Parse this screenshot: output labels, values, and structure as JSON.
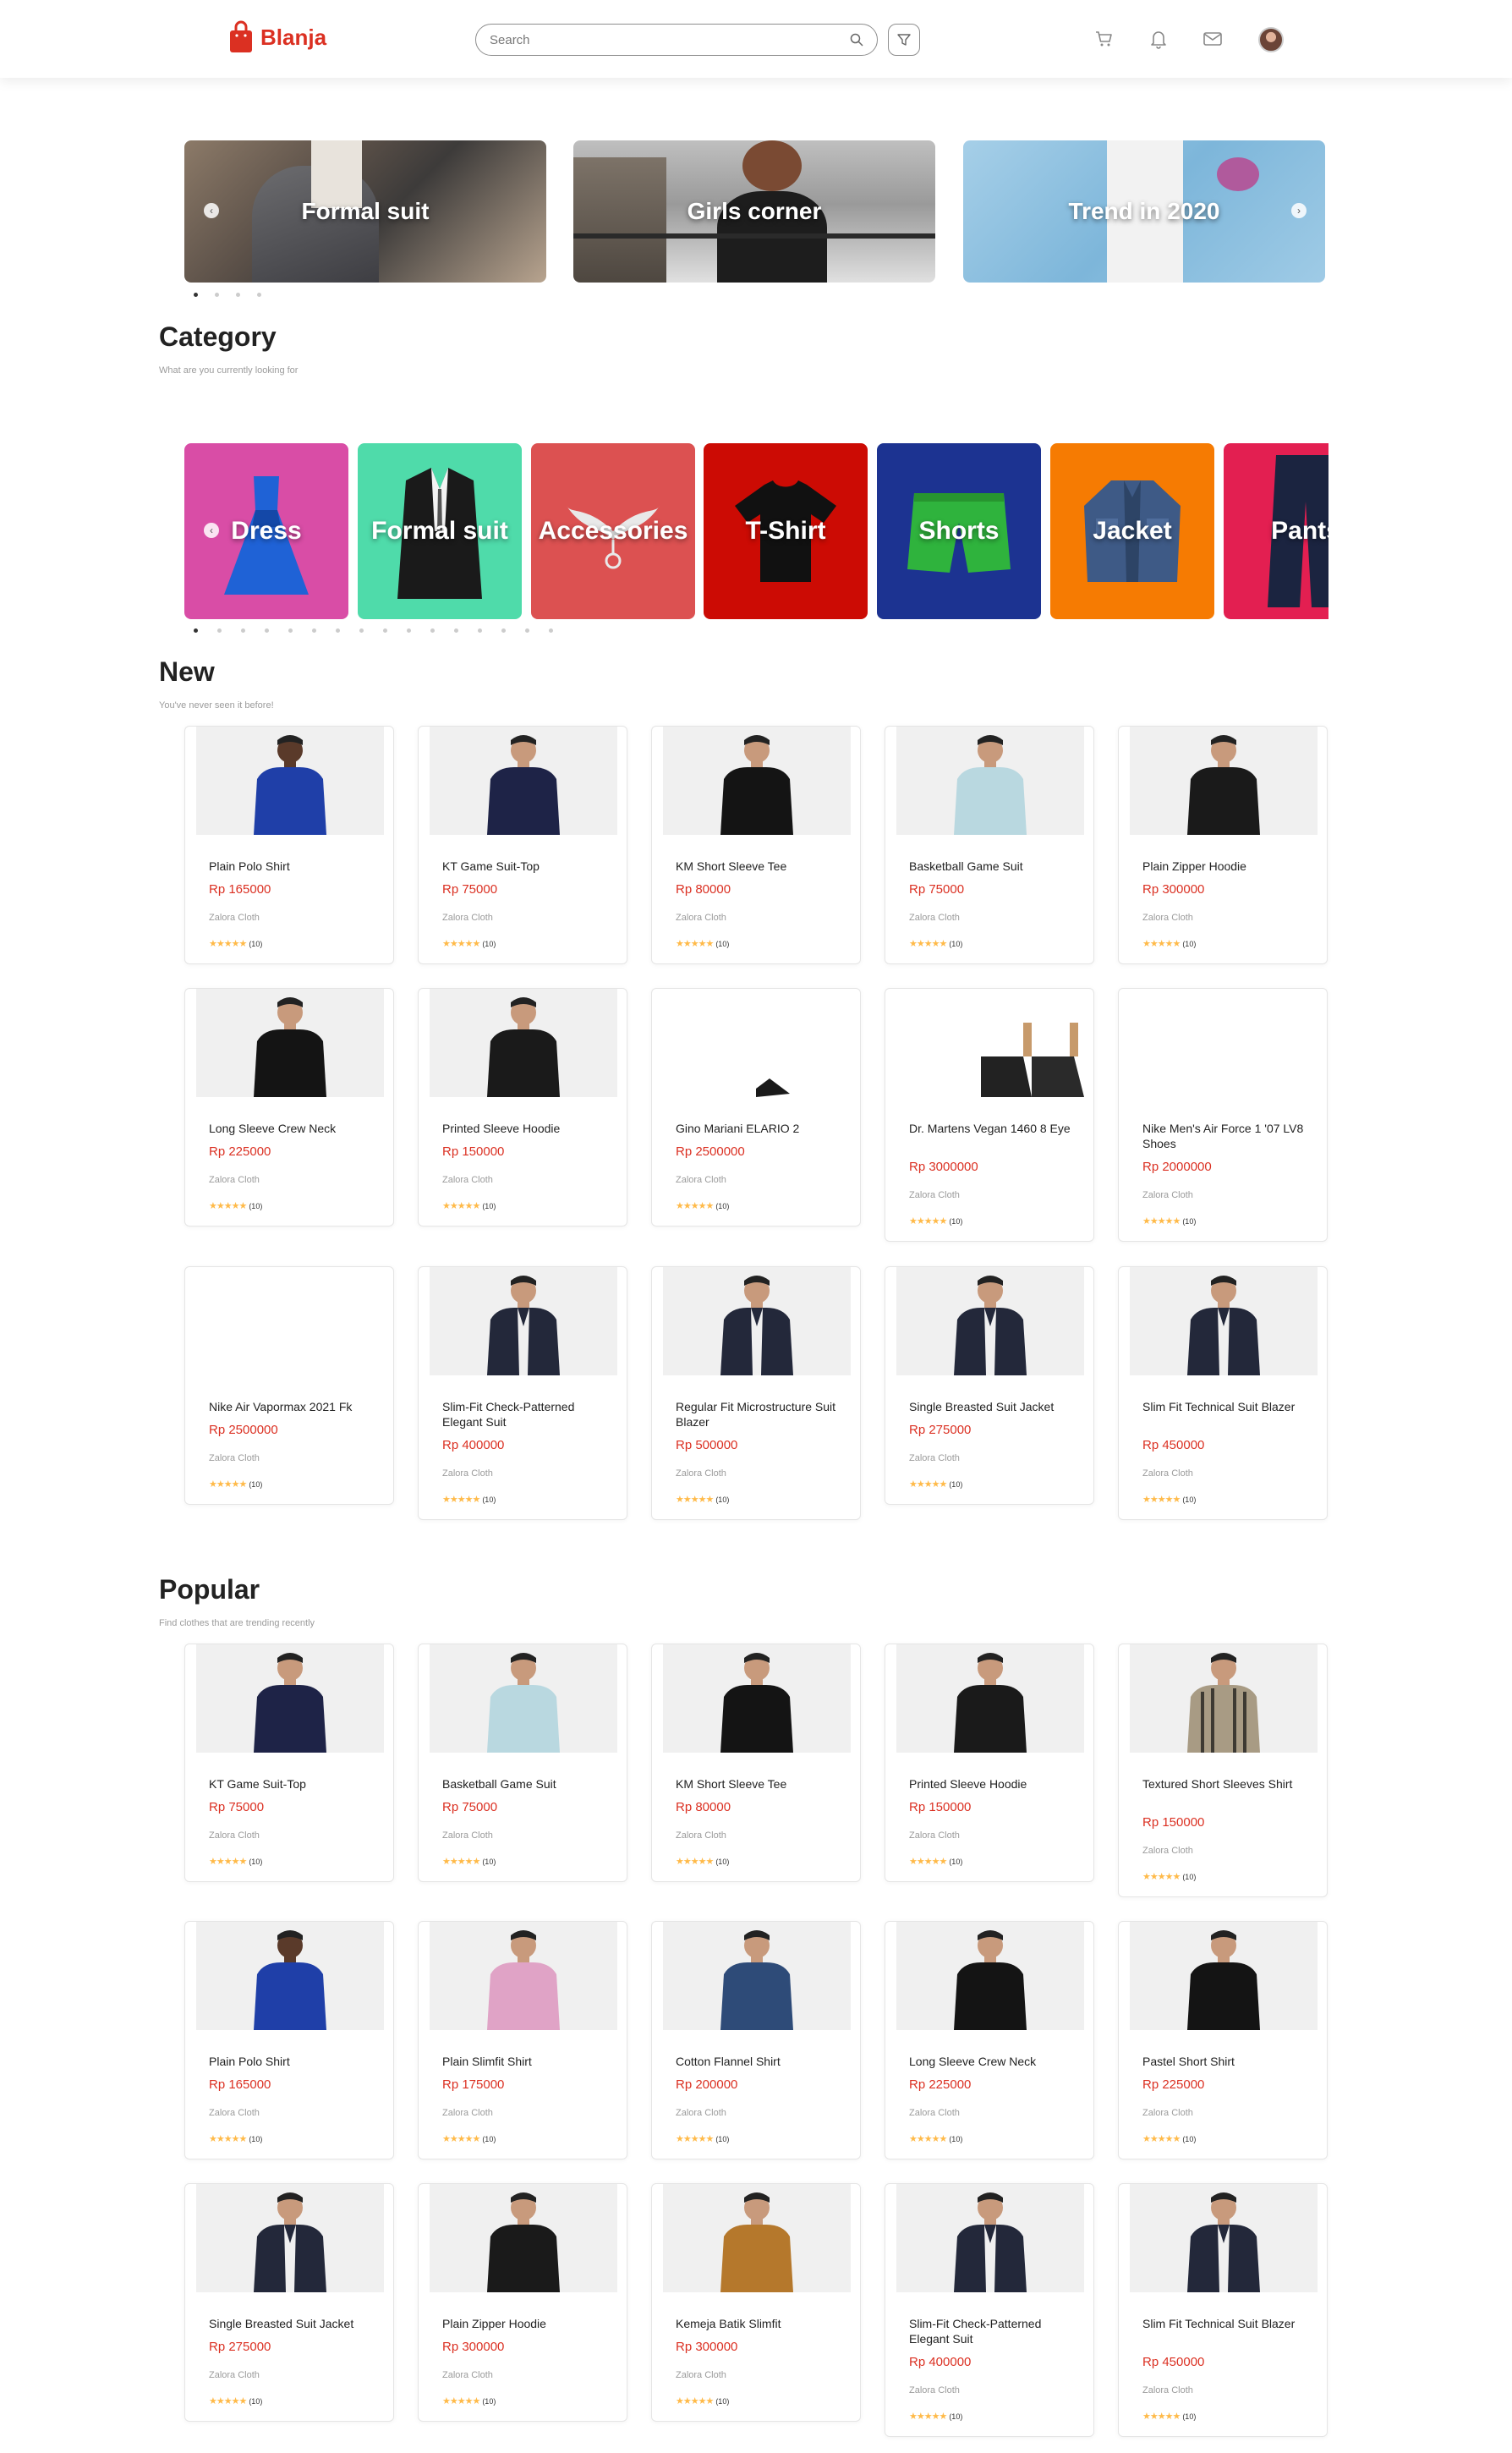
{
  "app": {
    "name": "Blanja"
  },
  "search": {
    "placeholder": "Search"
  },
  "colors": {
    "primary": "#DB3022",
    "star": "#FFBA49"
  },
  "banners": [
    {
      "title": "Formal suit"
    },
    {
      "title": "Girls corner"
    },
    {
      "title": "Trend in 2020"
    }
  ],
  "category": {
    "title": "Category",
    "subtitle": "What are you currently looking for",
    "items": [
      {
        "label": "Dress",
        "color": "#D94DA6"
      },
      {
        "label": "Formal suit",
        "color": "#4FDBAA"
      },
      {
        "label": "Accessories",
        "color": "#DC5151"
      },
      {
        "label": "T-Shirt",
        "color": "#CC0B04"
      },
      {
        "label": "Shorts",
        "color": "#1C3391"
      },
      {
        "label": "Jacket",
        "color": "#F67B02"
      },
      {
        "label": "Pants",
        "color": "#E31F51"
      }
    ]
  },
  "new": {
    "title": "New",
    "subtitle": "You've never seen it before!",
    "products": [
      {
        "name": "Plain Polo Shirt",
        "price": "Rp 165000",
        "store": "Zalora Cloth",
        "rating": "(10)"
      },
      {
        "name": "KT Game Suit-Top",
        "price": "Rp 75000",
        "store": "Zalora Cloth",
        "rating": "(10)"
      },
      {
        "name": "KM Short Sleeve Tee",
        "price": "Rp 80000",
        "store": "Zalora Cloth",
        "rating": "(10)"
      },
      {
        "name": "Basketball Game Suit",
        "price": "Rp 75000",
        "store": "Zalora Cloth",
        "rating": "(10)"
      },
      {
        "name": "Plain Zipper Hoodie",
        "price": "Rp 300000",
        "store": "Zalora Cloth",
        "rating": "(10)"
      },
      {
        "name": "Long Sleeve Crew Neck",
        "price": "Rp 225000",
        "store": "Zalora Cloth",
        "rating": "(10)"
      },
      {
        "name": "Printed Sleeve Hoodie",
        "price": "Rp 150000",
        "store": "Zalora Cloth",
        "rating": "(10)"
      },
      {
        "name": "Gino Mariani ELARIO 2",
        "price": "Rp 2500000",
        "store": "Zalora Cloth",
        "rating": "(10)"
      },
      {
        "name": "Dr. Martens Vegan 1460 8 Eye",
        "price": "Rp 3000000",
        "store": "Zalora Cloth",
        "rating": "(10)"
      },
      {
        "name": "Nike Men's Air Force 1 '07 LV8 Shoes",
        "price": "Rp 2000000",
        "store": "Zalora Cloth",
        "rating": "(10)"
      },
      {
        "name": "Nike Air Vapormax 2021 Fk",
        "price": "Rp 2500000",
        "store": "Zalora Cloth",
        "rating": "(10)"
      },
      {
        "name": "Slim-Fit Check-Patterned Elegant Suit",
        "price": "Rp 400000",
        "store": "Zalora Cloth",
        "rating": "(10)"
      },
      {
        "name": "Regular Fit Microstructure Suit Blazer",
        "price": "Rp 500000",
        "store": "Zalora Cloth",
        "rating": "(10)"
      },
      {
        "name": "Single Breasted Suit Jacket",
        "price": "Rp 275000",
        "store": "Zalora Cloth",
        "rating": "(10)"
      },
      {
        "name": "Slim Fit Technical Suit Blazer",
        "price": "Rp 450000",
        "store": "Zalora Cloth",
        "rating": "(10)"
      }
    ]
  },
  "popular": {
    "title": "Popular",
    "subtitle": "Find clothes that are trending recently",
    "products": [
      {
        "name": "KT Game Suit-Top",
        "price": "Rp 75000",
        "store": "Zalora Cloth",
        "rating": "(10)"
      },
      {
        "name": "Basketball Game Suit",
        "price": "Rp 75000",
        "store": "Zalora Cloth",
        "rating": "(10)"
      },
      {
        "name": "KM Short Sleeve Tee",
        "price": "Rp 80000",
        "store": "Zalora Cloth",
        "rating": "(10)"
      },
      {
        "name": "Printed Sleeve Hoodie",
        "price": "Rp 150000",
        "store": "Zalora Cloth",
        "rating": "(10)"
      },
      {
        "name": "Textured Short Sleeves Shirt",
        "price": "Rp 150000",
        "store": "Zalora Cloth",
        "rating": "(10)"
      },
      {
        "name": "Plain Polo Shirt",
        "price": "Rp 165000",
        "store": "Zalora Cloth",
        "rating": "(10)"
      },
      {
        "name": "Plain Slimfit Shirt",
        "price": "Rp 175000",
        "store": "Zalora Cloth",
        "rating": "(10)"
      },
      {
        "name": "Cotton Flannel Shirt",
        "price": "Rp 200000",
        "store": "Zalora Cloth",
        "rating": "(10)"
      },
      {
        "name": "Long Sleeve Crew Neck",
        "price": "Rp 225000",
        "store": "Zalora Cloth",
        "rating": "(10)"
      },
      {
        "name": "Pastel Short Shirt",
        "price": "Rp 225000",
        "store": "Zalora Cloth",
        "rating": "(10)"
      },
      {
        "name": "Single Breasted Suit Jacket",
        "price": "Rp 275000",
        "store": "Zalora Cloth",
        "rating": "(10)"
      },
      {
        "name": "Plain Zipper Hoodie",
        "price": "Rp 300000",
        "store": "Zalora Cloth",
        "rating": "(10)"
      },
      {
        "name": "Kemeja Batik Slimfit",
        "price": "Rp 300000",
        "store": "Zalora Cloth",
        "rating": "(10)"
      },
      {
        "name": "Slim-Fit Check-Patterned Elegant Suit",
        "price": "Rp 400000",
        "store": "Zalora Cloth",
        "rating": "(10)"
      },
      {
        "name": "Slim Fit Technical Suit Blazer",
        "price": "Rp 450000",
        "store": "Zalora Cloth",
        "rating": "(10)"
      }
    ]
  }
}
